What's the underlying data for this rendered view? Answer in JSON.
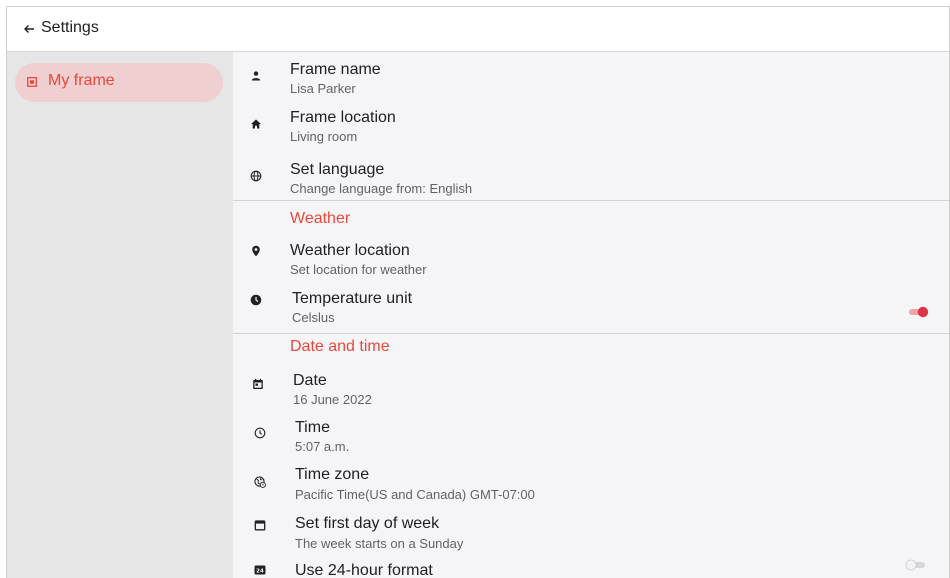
{
  "header": {
    "title": "Settings"
  },
  "sidebar": {
    "items": [
      {
        "label": "My frame"
      }
    ]
  },
  "general": {
    "rows": [
      {
        "label": "Frame name",
        "value": "Lisa Parker",
        "icon": "person-icon"
      },
      {
        "label": "Frame location",
        "value": "Living room",
        "icon": "home-icon"
      },
      {
        "label": "Set language",
        "value": "Change language from: English",
        "icon": "globe-icon"
      }
    ]
  },
  "weather": {
    "title": "Weather",
    "rows": [
      {
        "label": "Weather location",
        "value": "Set location for weather",
        "icon": "location-pin-icon"
      },
      {
        "label": "Temperature unit",
        "value": "Celslus",
        "icon": "clock-icon",
        "toggle": true
      }
    ]
  },
  "datetime": {
    "title": "Date and time",
    "rows": [
      {
        "label": "Date",
        "value": "16 June 2022",
        "icon": "calendar-icon"
      },
      {
        "label": "Time",
        "value": "5:07 a.m.",
        "icon": "clock-outline-icon"
      },
      {
        "label": "Time zone",
        "value": "Pacific Time(US and Canada) GMT-07:00",
        "icon": "timezone-globe-icon"
      },
      {
        "label": "Set first day of week",
        "value": "The week starts on a Sunday",
        "icon": "calendar-outline-icon"
      },
      {
        "label": "Use 24-hour format",
        "value": "",
        "icon": "24h-icon",
        "toggle": false
      }
    ]
  },
  "colors": {
    "accent": "#e8483c",
    "active_nav_bg": "#f0cfd1",
    "sidebar_bg": "#e6e6e6",
    "content_bg": "#f5f5f7"
  }
}
